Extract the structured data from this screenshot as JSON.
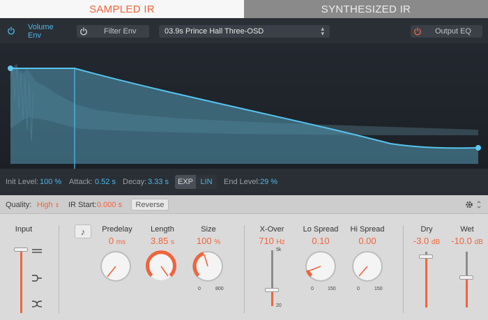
{
  "tabs": {
    "sampled": "SAMPLED IR",
    "synthesized": "SYNTHESIZED IR"
  },
  "display": {
    "volume_env": "Volume Env",
    "filter_env": "Filter Env",
    "ir_name": "03.9s Prince Hall Three-OSD",
    "output_eq": "Output EQ"
  },
  "envelope": {
    "init_level_label": "Init Level:",
    "init_level_value": "100 %",
    "attack_label": "Attack:",
    "attack_value": "0.52 s",
    "decay_label": "Decay:",
    "decay_value": "3.33 s",
    "exp": "EXP",
    "lin": "LIN",
    "end_level_label": "End Level:",
    "end_level_value": "29 %"
  },
  "quality": {
    "quality_label": "Quality:",
    "quality_value": "High",
    "ir_start_label": "IR Start:",
    "ir_start_value": "0.000 s",
    "reverse": "Reverse"
  },
  "controls": {
    "input_label": "Input",
    "predelay_label": "Predelay",
    "predelay_value": "0",
    "predelay_unit": "ms",
    "length_label": "Length",
    "length_value": "3.85",
    "length_unit": "s",
    "size_label": "Size",
    "size_value": "100",
    "size_unit": "%",
    "size_min": "0",
    "size_max": "800",
    "xover_label": "X-Over",
    "xover_value": "710",
    "xover_unit": "Hz",
    "xover_max": "5k",
    "xover_min": "20",
    "lo_spread_label": "Lo Spread",
    "lo_spread_value": "0.10",
    "lo_spread_min": "0",
    "lo_spread_max": "150",
    "hi_spread_label": "Hi Spread",
    "hi_spread_value": "0.00",
    "hi_spread_min": "0",
    "hi_spread_max": "150",
    "dry_label": "Dry",
    "dry_value": "-3.0",
    "dry_unit": "dB",
    "wet_label": "Wet",
    "wet_value": "-10.0",
    "wet_unit": "dB"
  },
  "colors": {
    "accent": "#f0643c",
    "blue": "#4db8e8"
  },
  "icons": {
    "volume_power": "power-icon",
    "filter_power": "power-icon",
    "eq_power": "power-icon",
    "settings": "gear-icon",
    "note": "note-icon"
  }
}
